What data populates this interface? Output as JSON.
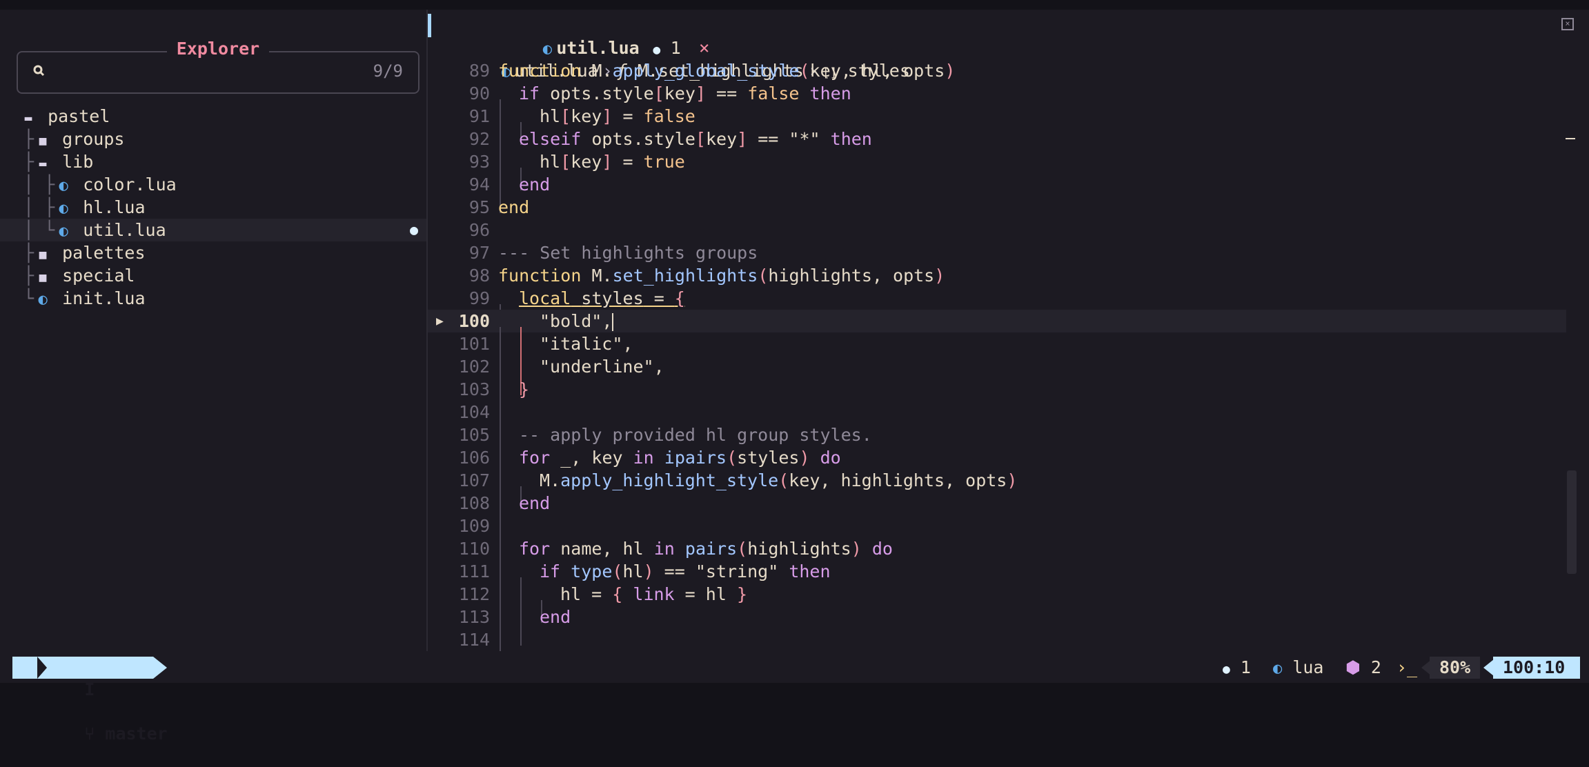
{
  "sidebar": {
    "title": "Explorer",
    "search": {
      "placeholder": "",
      "count": "9/9"
    },
    "tree": [
      {
        "label": "pastel",
        "kind": "folder-open",
        "prefix": ""
      },
      {
        "label": "groups",
        "kind": "folder",
        "prefix": "├"
      },
      {
        "label": "lib",
        "kind": "folder-open",
        "prefix": "├"
      },
      {
        "label": "color.lua",
        "kind": "lua",
        "prefix": "│ ├"
      },
      {
        "label": "hl.lua",
        "kind": "lua",
        "prefix": "│ ├"
      },
      {
        "label": "util.lua",
        "kind": "lua",
        "prefix": "│ └",
        "selected": true,
        "hint": true
      },
      {
        "label": "palettes",
        "kind": "folder",
        "prefix": "├"
      },
      {
        "label": "special",
        "kind": "folder",
        "prefix": "├"
      },
      {
        "label": "init.lua",
        "kind": "lua",
        "prefix": "└"
      }
    ]
  },
  "tab": {
    "name": "util.lua",
    "diagnostics": "1",
    "close": "×"
  },
  "breadcrumb": {
    "file": "util.lua",
    "func": "M.set_highlights",
    "symbol": "styles"
  },
  "code": {
    "current_line": "100",
    "lines": [
      "89",
      "90",
      "91",
      "92",
      "93",
      "94",
      "95",
      "96",
      "97",
      "98",
      "99",
      "100",
      "101",
      "102",
      "103",
      "104",
      "105",
      "106",
      "107",
      "108",
      "109",
      "110",
      "111",
      "112",
      "113",
      "114"
    ]
  },
  "statusline": {
    "mode": "I",
    "branch": "master",
    "hints": "1",
    "filetype": "lua",
    "lsp_count": "2",
    "percent": "80%",
    "position": "100:10"
  },
  "colors": {
    "background": "#1c1a22",
    "accent": "#bfe6ff",
    "keyword": "#f6d48a",
    "function": "#a3c7ff",
    "paren": "#f09aa8",
    "comment": "#8f8998",
    "lua_icon": "#5ea9e8"
  }
}
